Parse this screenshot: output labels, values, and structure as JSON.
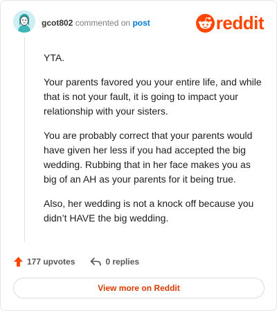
{
  "header": {
    "username": "gcot802",
    "action_text": "commented on",
    "post_link": "post",
    "logo_text": "reddit"
  },
  "comment": {
    "paragraphs": [
      "YTA.",
      "Your parents favored you your entire life, and while that is not your fault, it is going to impact your relationship with your sisters.",
      "You are probably correct that your parents would have given her less if you had accepted the big wedding. Rubbing that in her face makes you as big of an AH as your parents for it being true.",
      "Also, her wedding is not a knock off because you didn’t HAVE the big wedding."
    ]
  },
  "actions": {
    "upvotes": "177 upvotes",
    "replies": "0 replies"
  },
  "footer": {
    "view_more": "View more on Reddit"
  },
  "colors": {
    "brand": "#ff4500",
    "link": "#0079d3",
    "button_text": "#d93a00"
  },
  "icons": [
    "avatar",
    "reddit-logo-icon",
    "upvote-arrow-icon",
    "reply-arrow-icon"
  ]
}
